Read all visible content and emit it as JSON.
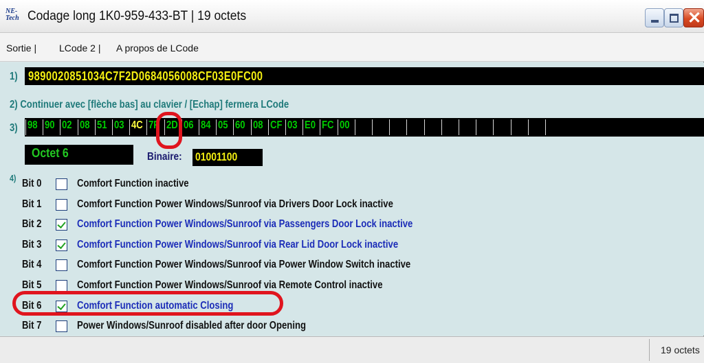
{
  "window": {
    "title": "Codage long  1K0-959-433-BT | 19 octets",
    "icon_text": [
      "NE-",
      "Tech"
    ],
    "controls": [
      "minimize-icon",
      "maximize-icon",
      "close-icon"
    ]
  },
  "menu": {
    "items": [
      "Sortie |",
      "LCode 2 |",
      "A propos de LCode"
    ]
  },
  "section1": {
    "marker": "1)",
    "code": "9890020851034C7F2D0684056008CF03E0FC00"
  },
  "section2": {
    "marker": "2)",
    "instruction": "Continuer avec [flèche bas] au clavier / [Echap] fermera LCode"
  },
  "section3": {
    "marker": "3)",
    "bytes": [
      "98",
      "90",
      "02",
      "08",
      "51",
      "03",
      "4C",
      "7F",
      "2D",
      "06",
      "84",
      "05",
      "60",
      "08",
      "CF",
      "03",
      "E0",
      "FC",
      "00"
    ],
    "selected_index": 6,
    "empty_cells": 12
  },
  "octet": {
    "label": "Octet 6",
    "binary_label": "Binaire:",
    "binary_value": "01001100"
  },
  "section4": {
    "marker": "4)",
    "bits": [
      {
        "label": "Bit 0",
        "checked": false,
        "description": "Comfort Function inactive"
      },
      {
        "label": "Bit 1",
        "checked": false,
        "description": "Comfort Function Power Windows/Sunroof via Drivers Door Lock inactive"
      },
      {
        "label": "Bit 2",
        "checked": true,
        "description": "Comfort Function Power Windows/Sunroof via Passengers Door Lock inactive"
      },
      {
        "label": "Bit 3",
        "checked": true,
        "description": "Comfort Function Power Windows/Sunroof via Rear Lid Door Lock inactive"
      },
      {
        "label": "Bit 4",
        "checked": false,
        "description": "Comfort Function Power Windows/Sunroof via Power Window Switch inactive"
      },
      {
        "label": "Bit 5",
        "checked": false,
        "description": "Comfort Function Power Windows/Sunroof via Remote Control inactive"
      },
      {
        "label": "Bit 6",
        "checked": true,
        "description": "Comfort Function automatic Closing"
      },
      {
        "label": "Bit 7",
        "checked": false,
        "description": "Power Windows/Sunroof disabled after door Opening"
      }
    ]
  },
  "status": {
    "text": "19 octets"
  },
  "colors": {
    "code_yellow": "#f3ee12",
    "byte_green": "#00cc00",
    "label_teal": "#1f7a7a",
    "checked_blue": "#1c2db8",
    "annotation_red": "#e0141e"
  }
}
